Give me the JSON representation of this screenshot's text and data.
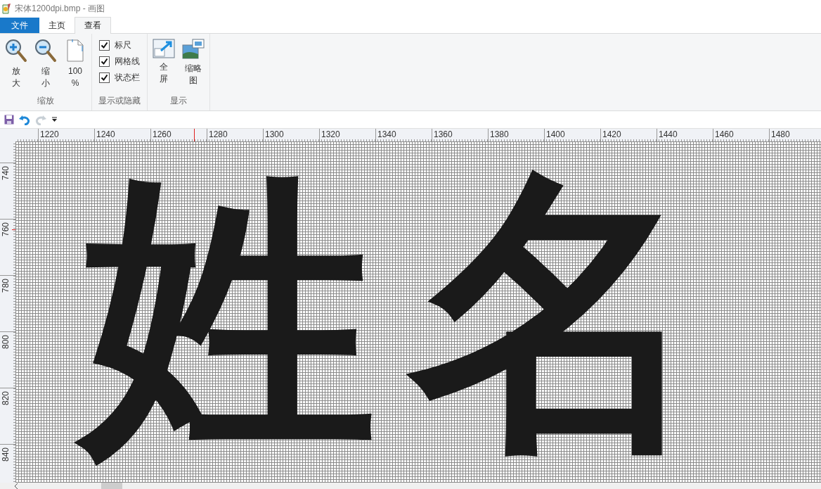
{
  "window": {
    "title": "宋体1200dpi.bmp - 画图"
  },
  "tabs": [
    {
      "label": "文件",
      "kind": "file",
      "selected": false
    },
    {
      "label": "主页",
      "kind": "tab",
      "selected": false
    },
    {
      "label": "查看",
      "kind": "tab",
      "selected": true
    }
  ],
  "ribbon": {
    "groups": [
      {
        "label": "缩放",
        "kind": "buttons",
        "items": [
          {
            "label": "放大"
          },
          {
            "label": "缩小"
          },
          {
            "label": "100%"
          }
        ]
      },
      {
        "label": "显示或隐藏",
        "kind": "checks",
        "items": [
          {
            "label": "标尺",
            "checked": true
          },
          {
            "label": "网格线",
            "checked": true
          },
          {
            "label": "状态栏",
            "checked": true
          }
        ]
      },
      {
        "label": "显示",
        "kind": "buttons",
        "items": [
          {
            "label": "全屏"
          },
          {
            "label": "缩略图"
          }
        ]
      }
    ]
  },
  "quick_access": [
    {
      "disabled": false
    },
    {
      "disabled": false
    },
    {
      "disabled": true
    },
    {
      "disabled": false
    }
  ],
  "ruler": {
    "horizontal": [
      "1220",
      "1240",
      "1260",
      "1280",
      "1300",
      "1320",
      "1340",
      "1360",
      "1380",
      "1400",
      "1420",
      "1440",
      "1460",
      "1480"
    ],
    "vertical": [
      "740",
      "760",
      "780",
      "800",
      "820",
      "840"
    ]
  },
  "canvas": {
    "characters": [
      "姓",
      "名"
    ]
  }
}
